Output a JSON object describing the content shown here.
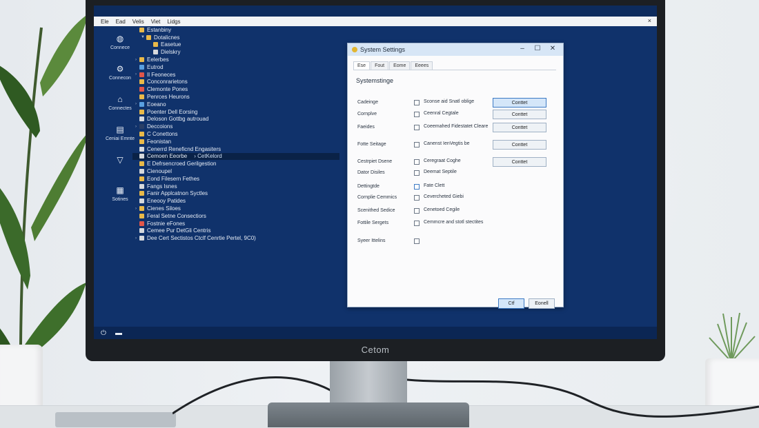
{
  "menubar": {
    "items": [
      "Ele",
      "Ead",
      "Velis",
      "Viet",
      "Lidgs"
    ],
    "close": "×"
  },
  "desktop_icons": [
    {
      "label": "Connece",
      "icon": "app-icon"
    },
    {
      "label": "Connecon",
      "icon": "settings-icon"
    },
    {
      "label": "Connectes",
      "icon": "network-icon"
    },
    {
      "label": "Ceniai Emnte",
      "icon": "document-icon"
    },
    {
      "label": "",
      "icon": "filter-icon"
    },
    {
      "label": "Sotines",
      "icon": "grid-icon"
    }
  ],
  "tree": [
    {
      "text": "Estanbiny",
      "exp": "",
      "color": "#e9b949",
      "indent": 0
    },
    {
      "text": "Dotalicnes",
      "exp": "▼",
      "color": "#e9b949",
      "indent": 1
    },
    {
      "text": "Easetue",
      "exp": "",
      "color": "#e9b949",
      "indent": 2
    },
    {
      "text": "Dielskry",
      "exp": "",
      "color": "#d6d9dd",
      "indent": 2
    },
    {
      "text": "Eelerbes",
      "exp": "›",
      "color": "#e9b949",
      "indent": 0
    },
    {
      "text": "Eutrod",
      "exp": "",
      "color": "#5aa0e0",
      "indent": 0
    },
    {
      "text": "Il Feoneces",
      "exp": "›",
      "color": "#e0564a",
      "indent": 0
    },
    {
      "text": "Conconrarietons",
      "exp": "",
      "color": "#e9b949",
      "indent": 0
    },
    {
      "text": "Clemonte Pones",
      "exp": "",
      "color": "#e0564a",
      "indent": 0
    },
    {
      "text": "Penrces Heurons",
      "exp": "",
      "color": "#e9b949",
      "indent": 0
    },
    {
      "text": "Eoeano",
      "exp": "›",
      "color": "#5aa0e0",
      "indent": 0
    },
    {
      "text": "Poenter Dell Eorsing",
      "exp": "",
      "color": "#e9b949",
      "indent": 0
    },
    {
      "text": "Deloson Gottbg autrouad",
      "exp": "",
      "color": "#d6d9dd",
      "indent": 0
    },
    {
      "text": "Deccoions",
      "exp": "›",
      "color": "#2a3f66",
      "indent": 0
    },
    {
      "text": "C Conettons",
      "exp": "",
      "color": "#e9b949",
      "indent": 0
    },
    {
      "text": "Feonistan",
      "exp": "",
      "color": "#e9b949",
      "indent": 0
    },
    {
      "text": "Cenerrd Reneficnd Engasiters",
      "exp": "",
      "color": "#d6d9dd",
      "indent": 0
    },
    {
      "text": "Cemoen Eeorbe",
      "exp": "",
      "color": "#d6d9dd",
      "indent": 0,
      "selected": true,
      "extra": "› CetKelord"
    },
    {
      "text": "E Defrsencroed Gerilgestion",
      "exp": "",
      "color": "#e9b949",
      "indent": 0
    },
    {
      "text": "Cienoupel",
      "exp": "",
      "color": "#d6d9dd",
      "indent": 0
    },
    {
      "text": "Eond Filesern Fethes",
      "exp": "",
      "color": "#e9b949",
      "indent": 0
    },
    {
      "text": "Fangs Isnes",
      "exp": "",
      "color": "#d6d9dd",
      "indent": 0
    },
    {
      "text": "Fanir Applcatnon Syctles",
      "exp": "",
      "color": "#e9b949",
      "indent": 0
    },
    {
      "text": "Eneooy Patides",
      "exp": "",
      "color": "#d6d9dd",
      "indent": 0
    },
    {
      "text": "Cienes Siloes",
      "exp": "›",
      "color": "#e9b949",
      "indent": 0
    },
    {
      "text": "Feral Setne Consectiors",
      "exp": "",
      "color": "#e9b949",
      "indent": 0
    },
    {
      "text": "Fostnie eFones",
      "exp": "",
      "color": "#e0564a",
      "indent": 0
    },
    {
      "text": "Cemee Pur DetGli Centris",
      "exp": "",
      "color": "#d6d9dd",
      "indent": 0
    },
    {
      "text": "Dee Cert Sectistos Ctclf Cenrtie Pertel, 9C0)",
      "exp": "›",
      "color": "#d6d9dd",
      "indent": 0
    }
  ],
  "dialog": {
    "title": "System Settings",
    "tabs": [
      "Ese",
      "Fout",
      "Eome",
      "Eeees"
    ],
    "heading": "Systemstinge",
    "rows": [
      {
        "label": "Cadeinge",
        "checked": false,
        "text": "Sconse aid Snatl oblige",
        "button": "Conttet",
        "primary": true
      },
      {
        "label": "Cornplve",
        "checked": false,
        "text": "Ceenral Cegtale",
        "button": "Conttet",
        "primary": false
      },
      {
        "label": "Faeides",
        "checked": false,
        "text": "Coeemahed Fidestatet Cleare",
        "button": "Conttet",
        "primary": false
      },
      {
        "label": "Fotte Seitage",
        "checked": false,
        "text": "Canenst IenVegtis be",
        "button": "Conttet",
        "primary": false
      },
      {
        "label": "Cestrpiet Dsene",
        "checked": false,
        "text": "Ceregraat Coghe",
        "button": "Conttet",
        "primary": false
      },
      {
        "label": "Dator Disiles",
        "checked": false,
        "text": "Deemat Septile",
        "button": "",
        "primary": false
      },
      {
        "label": "Dettingtde",
        "checked": true,
        "text": "Fate Clett",
        "button": "",
        "primary": false
      },
      {
        "label": "Cornplie Cemmics",
        "checked": false,
        "text": "Cevercheted Giebi",
        "button": "",
        "primary": false
      },
      {
        "label": "Scenithed Sedice",
        "checked": false,
        "text": "Cenetoed Cegile",
        "button": "",
        "primary": false
      },
      {
        "label": "Fottile Sergets",
        "checked": false,
        "text": "Cemmcre and stotl stectites",
        "button": "",
        "primary": false
      },
      {
        "label": "Syeer Ittelins",
        "checked": false,
        "text": "",
        "button": "",
        "primary": false
      }
    ],
    "ok": "Ctf",
    "cancel": "Eonell"
  },
  "brand": "Cetom",
  "taskbar": {
    "icons": [
      "power-icon",
      "folder-icon"
    ]
  }
}
